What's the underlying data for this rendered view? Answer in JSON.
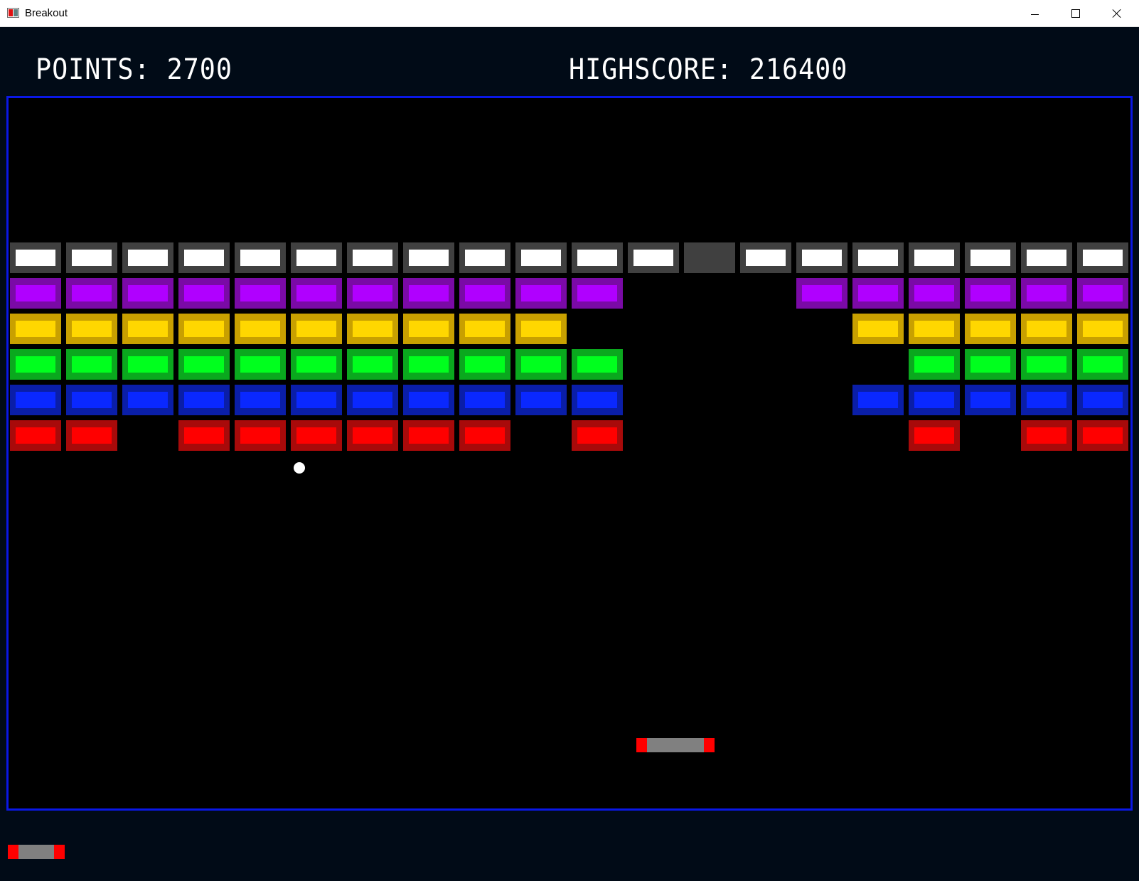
{
  "window": {
    "title": "Breakout",
    "controls": {
      "minimize": "minimize-icon",
      "maximize": "maximize-icon",
      "close": "close-icon"
    }
  },
  "hud": {
    "points": "POINTS: 2700",
    "highscore": "HIGHSCORE: 216400"
  },
  "colors": {
    "background": "#010b17",
    "playfield": "#000000",
    "border": "#0a18e6",
    "paddle_body": "#808080",
    "paddle_caps": "#ff0000",
    "ball": "#ffffff"
  },
  "bricks": {
    "columns": 20,
    "rows": [
      {
        "color_name": "white",
        "outer": "#404040",
        "inner": "#ffffff",
        "present": [
          1,
          1,
          1,
          1,
          1,
          1,
          1,
          1,
          1,
          1,
          1,
          1,
          2,
          1,
          1,
          1,
          1,
          1,
          1,
          1
        ]
      },
      {
        "color_name": "purple",
        "outer": "#7a0aa6",
        "inner": "#b000ff",
        "present": [
          1,
          1,
          1,
          1,
          1,
          1,
          1,
          1,
          1,
          1,
          1,
          0,
          0,
          0,
          1,
          1,
          1,
          1,
          1,
          1
        ]
      },
      {
        "color_name": "yellow",
        "outer": "#c8a000",
        "inner": "#ffd700",
        "present": [
          1,
          1,
          1,
          1,
          1,
          1,
          1,
          1,
          1,
          1,
          0,
          0,
          0,
          0,
          0,
          1,
          1,
          1,
          1,
          1
        ]
      },
      {
        "color_name": "green",
        "outer": "#0aa81e",
        "inner": "#00ff1e",
        "present": [
          1,
          1,
          1,
          1,
          1,
          1,
          1,
          1,
          1,
          1,
          1,
          0,
          0,
          0,
          0,
          0,
          1,
          1,
          1,
          1
        ]
      },
      {
        "color_name": "blue",
        "outer": "#0a1ea8",
        "inner": "#0a28ff",
        "present": [
          1,
          1,
          1,
          1,
          1,
          1,
          1,
          1,
          1,
          1,
          1,
          0,
          0,
          0,
          0,
          1,
          1,
          1,
          1,
          1
        ]
      },
      {
        "color_name": "red",
        "outer": "#a80a0a",
        "inner": "#ff0000",
        "present": [
          1,
          1,
          0,
          1,
          1,
          1,
          1,
          1,
          1,
          0,
          1,
          0,
          0,
          0,
          0,
          0,
          1,
          0,
          1,
          1
        ]
      }
    ],
    "damaged": {
      "outer": "#404040",
      "inner": "#404040"
    }
  },
  "lives_remaining": 1
}
